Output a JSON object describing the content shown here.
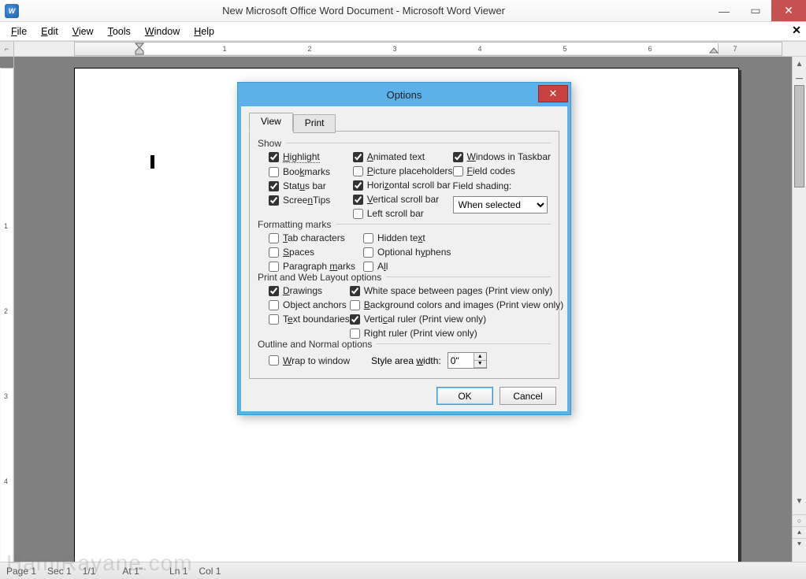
{
  "window": {
    "title": "New Microsoft Office Word Document - Microsoft Word Viewer"
  },
  "menubar": {
    "file": "File",
    "edit": "Edit",
    "view": "View",
    "tools": "Tools",
    "window": "Window",
    "help": "Help"
  },
  "ruler": {
    "numbers": [
      "1",
      "2",
      "3",
      "4",
      "5",
      "6",
      "7"
    ]
  },
  "statusbar": {
    "page": "Page  1",
    "sec": "Sec 1",
    "count": "1/1",
    "at": "At  1\"",
    "ln": "Ln  1",
    "col": "Col  1"
  },
  "watermark": "HamiRayane.com",
  "dialog": {
    "title": "Options",
    "tabs": {
      "view": "View",
      "print": "Print"
    },
    "groups": {
      "show": "Show",
      "formatting": "Formatting marks",
      "printweb": "Print and Web Layout options",
      "outline": "Outline and Normal options"
    },
    "show": {
      "highlight": "Highlight",
      "bookmarks": "Bookmarks",
      "statusbar": "Status bar",
      "screentips": "ScreenTips",
      "animated": "Animated text",
      "picture": "Picture placeholders",
      "hscroll": "Horizontal scroll bar",
      "vscroll": "Vertical scroll bar",
      "leftscroll": "Left scroll bar",
      "taskbar": "Windows in Taskbar",
      "fieldcodes": "Field codes",
      "fieldshading_label": "Field shading:",
      "fieldshading_value": "When selected"
    },
    "formatting": {
      "tab": "Tab characters",
      "spaces": "Spaces",
      "para": "Paragraph marks",
      "hidden": "Hidden text",
      "hyphens": "Optional hyphens",
      "all": "All"
    },
    "printweb": {
      "drawings": "Drawings",
      "anchors": "Object anchors",
      "boundaries": "Text boundaries",
      "whitespace": "White space between pages (Print view only)",
      "background": "Background colors and images (Print view only)",
      "vruler": "Vertical ruler (Print view only)",
      "rightruler": "Right ruler (Print view only)"
    },
    "outline": {
      "wrap": "Wrap to window",
      "stylearea_label": "Style area width:",
      "stylearea_value": "0\""
    },
    "buttons": {
      "ok": "OK",
      "cancel": "Cancel"
    }
  }
}
